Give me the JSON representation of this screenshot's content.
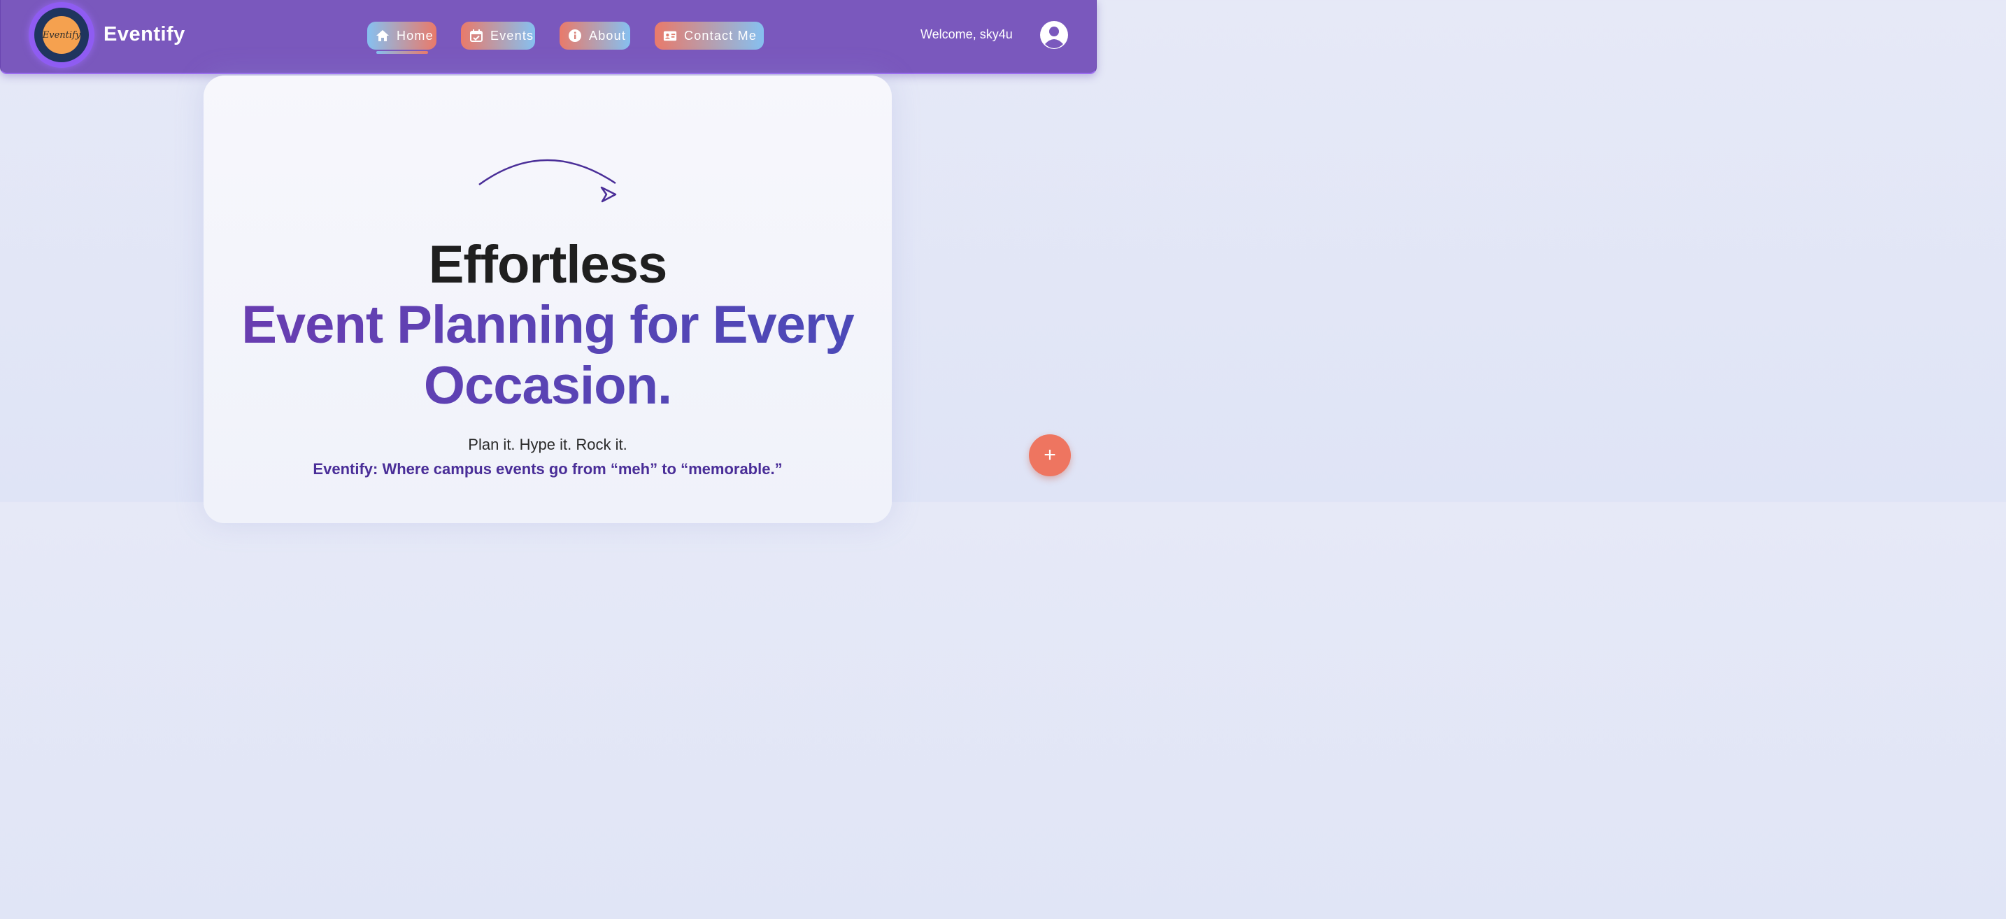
{
  "brand": {
    "logo_text": "Eventify",
    "name": "Eventify"
  },
  "nav": {
    "items": [
      {
        "label": "Home",
        "icon": "home-icon"
      },
      {
        "label": "Events",
        "icon": "calendar-icon"
      },
      {
        "label": "About",
        "icon": "info-icon"
      },
      {
        "label": "Contact Me",
        "icon": "contact-card-icon"
      }
    ],
    "active": "Home"
  },
  "user": {
    "welcome": "Welcome, sky4u",
    "avatar_icon": "user-avatar-icon"
  },
  "hero": {
    "line1": "Effortless",
    "line2": "Event Planning for Every",
    "line3": "Occasion.",
    "tagline": "Plan it. Hype it. Rock it.",
    "slogan": "Eventify: Where campus events go from “meh” to “memorable.”"
  },
  "fab": {
    "label": "+"
  },
  "colors": {
    "navbar": "#7a58bd",
    "accent_purple": "#5a3cb2",
    "fab": "#ee7560",
    "logo_orange": "#f5a14f"
  }
}
